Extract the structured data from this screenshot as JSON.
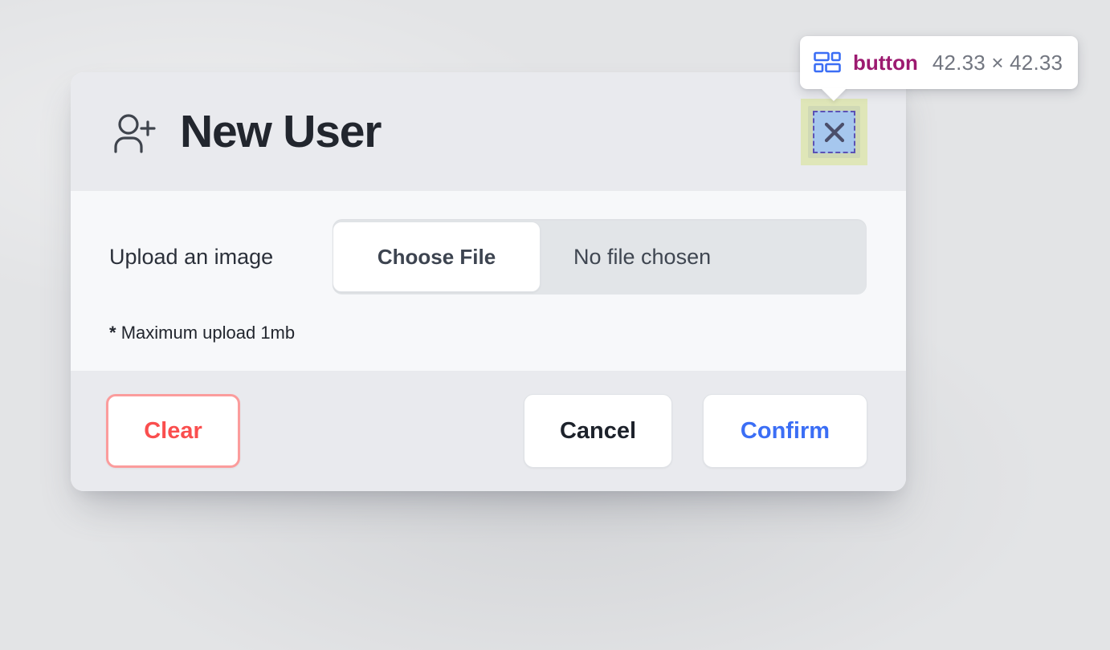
{
  "inspector": {
    "icon": "layout-grid-icon",
    "tag": "button",
    "dimensions": "42.33 × 42.33",
    "accent_color": "#9c1a70",
    "highlight_content_color": "#a6c7ee",
    "highlight_margin_color": "#dfe6b8",
    "highlight_border_color": "#5b52b5"
  },
  "modal": {
    "header": {
      "icon": "user-plus-icon",
      "title": "New User",
      "close_icon": "close-x-icon"
    },
    "body": {
      "upload_label": "Upload an image",
      "choose_file_label": "Choose File",
      "file_name": "No file chosen",
      "hint_star": "*",
      "hint_text": "Maximum upload 1mb"
    },
    "footer": {
      "clear_label": "Clear",
      "cancel_label": "Cancel",
      "confirm_label": "Confirm",
      "clear_color": "#fa4e4e",
      "confirm_color": "#3b6ef5",
      "cancel_color": "#1d222b"
    }
  }
}
